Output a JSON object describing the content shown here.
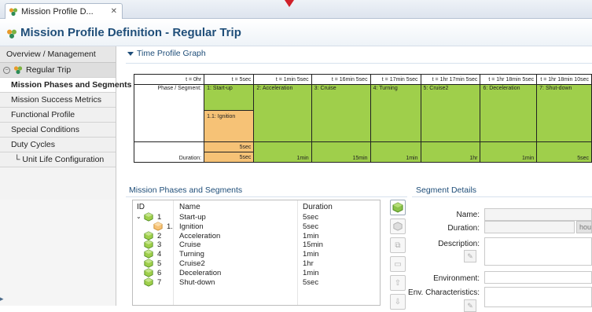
{
  "colors": {
    "phase_green": "#9fcf4b",
    "phase_orange": "#f6c276",
    "title_blue": "#1f4e79",
    "marker_red": "#d0202a"
  },
  "tab": {
    "label": "Mission Profile D...",
    "close": "✕",
    "icon": "mission-profile-icon"
  },
  "heading": {
    "title": "Mission Profile Definition - Regular Trip",
    "icon": "mission-profile-icon"
  },
  "nav": {
    "overview": "Overview / Management",
    "group": "Regular Trip",
    "items": [
      "Mission Phases and Segments",
      "Mission Success Metrics",
      "Functional Profile",
      "Special Conditions",
      "Duty Cycles",
      "└ Unit Life Configuration"
    ]
  },
  "time_profile": {
    "title": "Time Profile Graph",
    "times": [
      "t = 0hr",
      "t = 5sec",
      "t = 1min 5sec",
      "t = 16min 5sec",
      "t = 17min 5sec",
      "t = 1hr 17min 5sec",
      "t = 1hr 18min 5sec",
      "t = 1hr 18min 10sec"
    ],
    "phase_label": "Phase / Segment:",
    "phases": [
      "1: Start-up",
      "2: Acceleration",
      "3: Cruise",
      "4: Turning",
      "5: Cruise2",
      "6: Deceleration",
      "7: Shut-down"
    ],
    "segment": "1.1: Ignition",
    "segment_duration": "5sec",
    "duration_label": "Duration:",
    "durations": [
      "5sec",
      "1min",
      "15min",
      "1min",
      "1hr",
      "1min",
      "5sec"
    ]
  },
  "phases_panel": {
    "title": "Mission Phases and Segments",
    "columns": {
      "id": "ID",
      "name": "Name",
      "duration": "Duration"
    },
    "rows": [
      {
        "id": "1",
        "name": "Start-up",
        "duration": "5sec",
        "kind": "phase",
        "expanded": true
      },
      {
        "id": "1.",
        "name": "Ignition",
        "duration": "5sec",
        "kind": "segment"
      },
      {
        "id": "2",
        "name": "Acceleration",
        "duration": "1min",
        "kind": "phase"
      },
      {
        "id": "3",
        "name": "Cruise",
        "duration": "15min",
        "kind": "phase"
      },
      {
        "id": "4",
        "name": "Turning",
        "duration": "1min",
        "kind": "phase"
      },
      {
        "id": "5",
        "name": "Cruise2",
        "duration": "1hr",
        "kind": "phase"
      },
      {
        "id": "6",
        "name": "Deceleration",
        "duration": "1min",
        "kind": "phase"
      },
      {
        "id": "7",
        "name": "Shut-down",
        "duration": "5sec",
        "kind": "phase"
      }
    ]
  },
  "segment_details": {
    "title": "Segment Details",
    "name_label": "Name:",
    "duration_label": "Duration:",
    "duration_unit": "hou",
    "description_label": "Description:",
    "environment_label": "Environment:",
    "env_characteristics_label": "Env. Characteristics:"
  }
}
